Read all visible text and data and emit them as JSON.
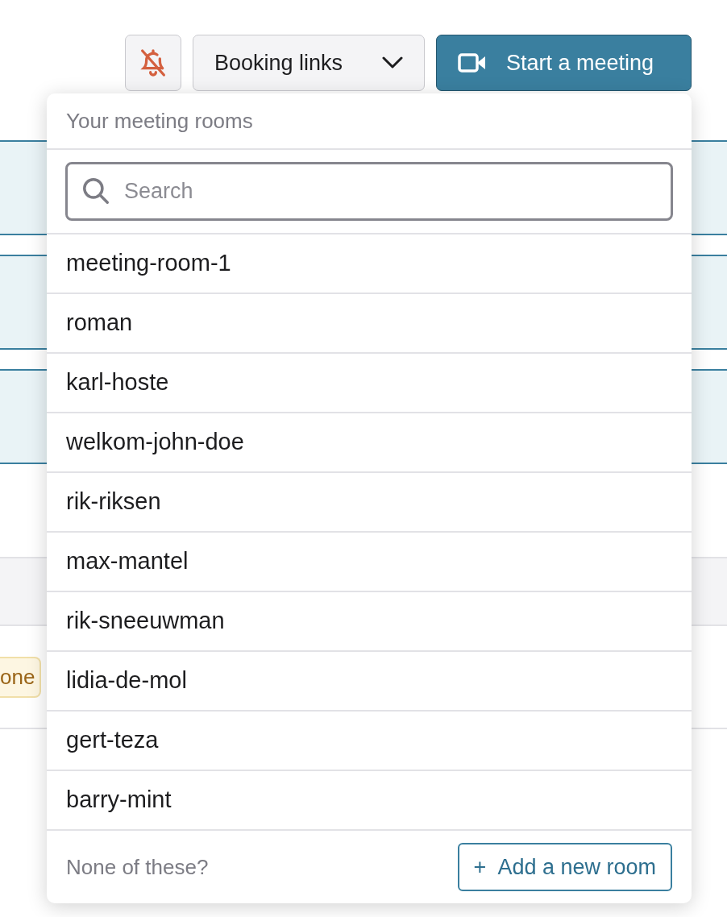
{
  "toolbar": {
    "notifications_muted": true,
    "booking_links": {
      "label": "Booking links"
    },
    "start_meeting": {
      "label": "Start a meeting"
    }
  },
  "background": {
    "badge": "one"
  },
  "dropdown": {
    "header": "Your meeting rooms",
    "search": {
      "placeholder": "Search"
    },
    "rooms": [
      "meeting-room-1",
      "roman",
      "karl-hoste",
      "welkom-john-doe",
      "rik-riksen",
      "max-mantel",
      "rik-sneeuwman",
      "lidia-de-mol",
      "gert-teza",
      "barry-mint"
    ],
    "footer": {
      "text": "None of these?",
      "add_button": {
        "icon": "+",
        "label": "Add a new room"
      }
    }
  }
}
